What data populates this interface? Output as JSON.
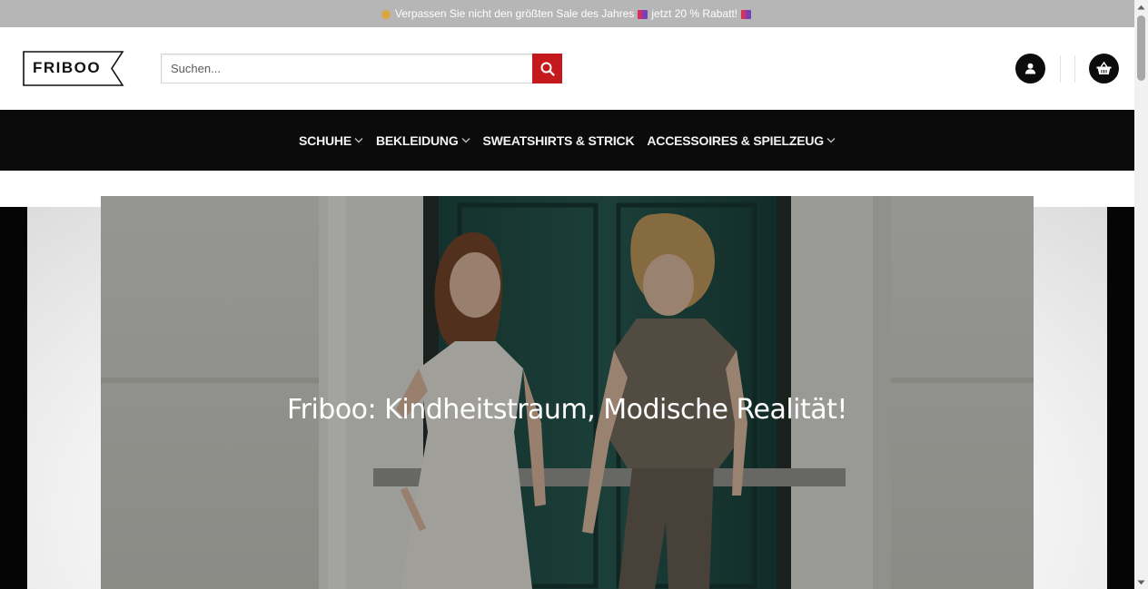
{
  "announcement": {
    "prefix_emoji": "money-bag",
    "text_main": "Verpassen Sie nicht den größten Sale des Jahres",
    "text_discount": "jetzt 20 % Rabatt!",
    "suffix_emoji": "gift"
  },
  "header": {
    "logo_text": "FRIBOO",
    "search": {
      "placeholder": "Suchen..."
    },
    "icons": {
      "search": "search-icon",
      "account": "user-icon",
      "cart": "basket-icon"
    }
  },
  "nav": {
    "items": [
      {
        "label": "SCHUHE",
        "has_dropdown": true
      },
      {
        "label": "BEKLEIDUNG",
        "has_dropdown": true
      },
      {
        "label": "SWEATSHIRTS & STRICK",
        "has_dropdown": false
      },
      {
        "label": "ACCESSOIRES & SPIELZEUG",
        "has_dropdown": true
      }
    ]
  },
  "hero": {
    "title": "Friboo: Kindheitstraum, Modische Realität!"
  },
  "colors": {
    "topbar": "#b6b6b6",
    "search_button": "#c41a1d",
    "nav_bg": "#0b0b0b",
    "icon_bg": "#0c0c0c"
  }
}
